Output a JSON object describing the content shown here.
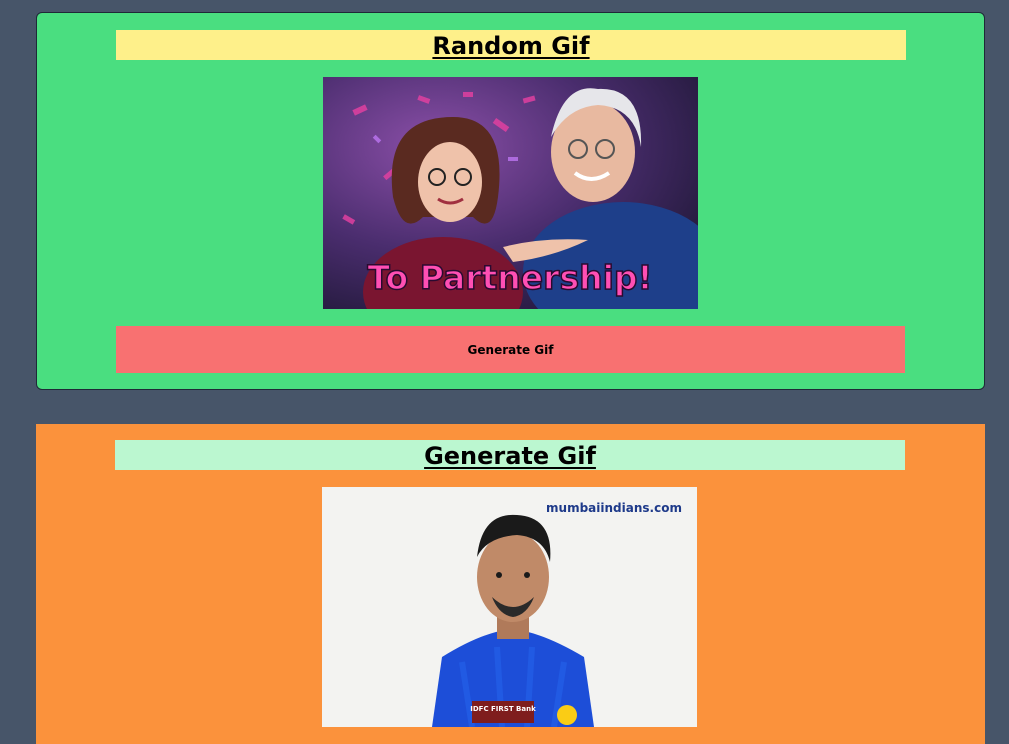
{
  "random_card": {
    "title": "Random Gif",
    "gif_caption": "To Partnership!",
    "button_label": "Generate Gif"
  },
  "tag_card": {
    "title": "Generate Gif",
    "gif_watermark": "mumbaiindians.com",
    "jersey_sponsor": "IDFC FIRST Bank"
  },
  "colors": {
    "page_background": "#475569",
    "random_card_background": "#4ade80",
    "random_title_background": "#fef08a",
    "button_background": "#f87171",
    "tag_card_background": "#fb923c",
    "tag_title_background": "#bbf7d0"
  }
}
